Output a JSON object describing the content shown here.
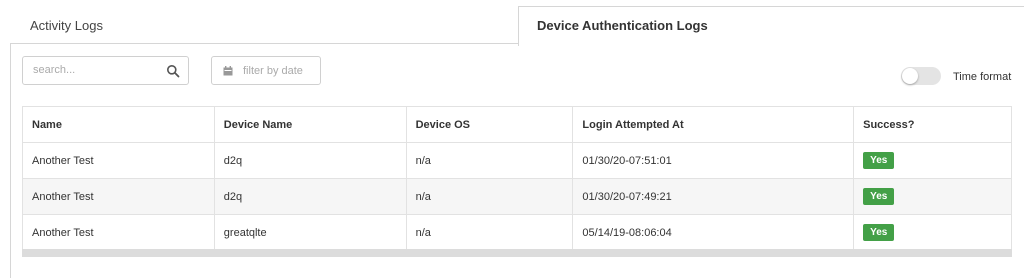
{
  "tabs": {
    "activity": "Activity Logs",
    "device": "Device Authentication Logs"
  },
  "toolbar": {
    "search_placeholder": "search...",
    "date_filter_placeholder": "filter by date",
    "time_format_label": "Time format",
    "time_format_on": false
  },
  "table": {
    "headers": [
      "Name",
      "Device Name",
      "Device OS",
      "Login Attempted At",
      "Success?"
    ],
    "rows": [
      {
        "name": "Another Test",
        "device_name": "d2q",
        "device_os": "n/a",
        "login_at": "01/30/20-07:51:01",
        "success": "Yes"
      },
      {
        "name": "Another Test",
        "device_name": "d2q",
        "device_os": "n/a",
        "login_at": "01/30/20-07:49:21",
        "success": "Yes"
      },
      {
        "name": "Another Test",
        "device_name": "greatqlte",
        "device_os": "n/a",
        "login_at": "05/14/19-08:06:04",
        "success": "Yes"
      }
    ]
  },
  "colors": {
    "success_badge": "#43a047",
    "border": "#d6d6d6"
  },
  "icons": {
    "search": "search-icon",
    "date": "calendar-icon"
  }
}
